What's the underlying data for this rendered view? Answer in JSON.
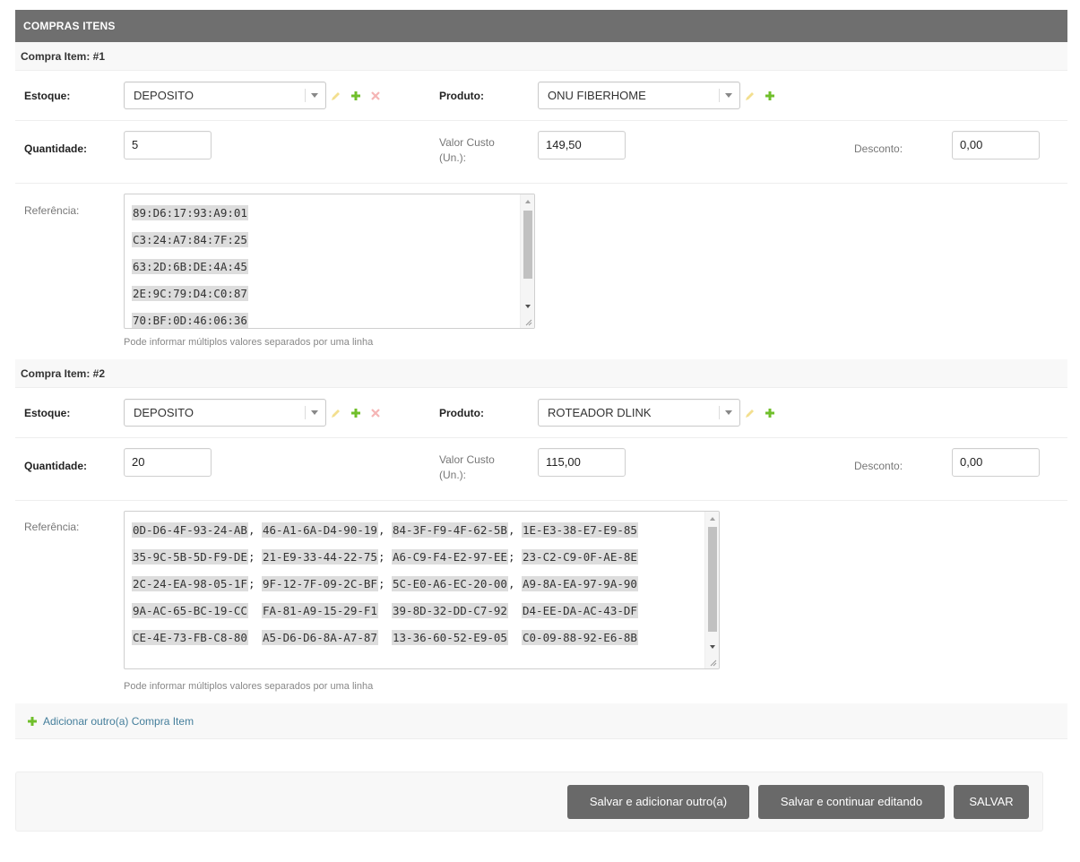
{
  "module": {
    "title": "COMPRAS ITENS",
    "add_label": "Adicionar outro(a) Compra Item"
  },
  "labels": {
    "estoque": "Estoque:",
    "produto": "Produto:",
    "quantidade": "Quantidade:",
    "valor_custo_line1": "Valor Custo",
    "valor_custo_line2": "(Un.):",
    "desconto": "Desconto:",
    "referencia": "Referência:",
    "help": "Pode informar múltiplos valores separados por uma linha"
  },
  "items": [
    {
      "header": "Compra Item: #1",
      "estoque": "DEPOSITO",
      "produto": "ONU FIBERHOME",
      "quantidade": "5",
      "valor_custo": "149,50",
      "desconto": "0,00",
      "referencia_lines": [
        "89:D6:17:93:A9:01",
        "C3:24:A7:84:7F:25",
        "63:2D:6B:DE:4A:45",
        "2E:9C:79:D4:C0:87",
        "70:BF:0D:46:06:36"
      ]
    },
    {
      "header": "Compra Item: #2",
      "estoque": "DEPOSITO",
      "produto": "ROTEADOR DLINK",
      "quantidade": "20",
      "valor_custo": "115,00",
      "desconto": "0,00",
      "referencia_lines": [
        [
          [
            "0D-D6-4F-93-24-AB",
            ", "
          ],
          [
            "46-A1-6A-D4-90-19",
            ", "
          ],
          [
            "84-3F-F9-4F-62-5B",
            ", "
          ],
          [
            "1E-E3-38-E7-E9-85",
            ""
          ]
        ],
        [
          [
            "35-9C-5B-5D-F9-DE",
            "; "
          ],
          [
            "21-E9-33-44-22-75",
            "; "
          ],
          [
            "A6-C9-F4-E2-97-EE",
            "; "
          ],
          [
            "23-C2-C9-0F-AE-8E",
            ""
          ]
        ],
        [
          [
            "2C-24-EA-98-05-1F",
            "; "
          ],
          [
            "9F-12-7F-09-2C-BF",
            "; "
          ],
          [
            "5C-E0-A6-EC-20-00",
            ", "
          ],
          [
            "A9-8A-EA-97-9A-90",
            ""
          ]
        ],
        [
          [
            "9A-AC-65-BC-19-CC",
            "  "
          ],
          [
            "FA-81-A9-15-29-F1",
            "  "
          ],
          [
            "39-8D-32-DD-C7-92",
            "  "
          ],
          [
            "D4-EE-DA-AC-43-DF",
            ""
          ]
        ],
        [
          [
            "CE-4E-73-FB-C8-80",
            "  "
          ],
          [
            "A5-D6-D6-8A-A7-87",
            "  "
          ],
          [
            "13-36-60-52-E9-05",
            "  "
          ],
          [
            "C0-09-88-92-E6-8B",
            ""
          ]
        ]
      ]
    }
  ],
  "buttons": {
    "save_add": "Salvar e adicionar outro(a)",
    "save_continue": "Salvar e continuar editando",
    "save": "SALVAR"
  },
  "colors": {
    "header_bg": "#6f6f6f",
    "button_bg": "#696969",
    "edit_icon": "#f0d675",
    "add_icon": "#70bf2b",
    "delete_icon": "#f5b5b5",
    "link": "#447e9b"
  },
  "icons": {
    "edit": "pencil-icon",
    "add": "plus-icon",
    "delete": "x-icon",
    "dropdown": "chevron-down-icon"
  }
}
